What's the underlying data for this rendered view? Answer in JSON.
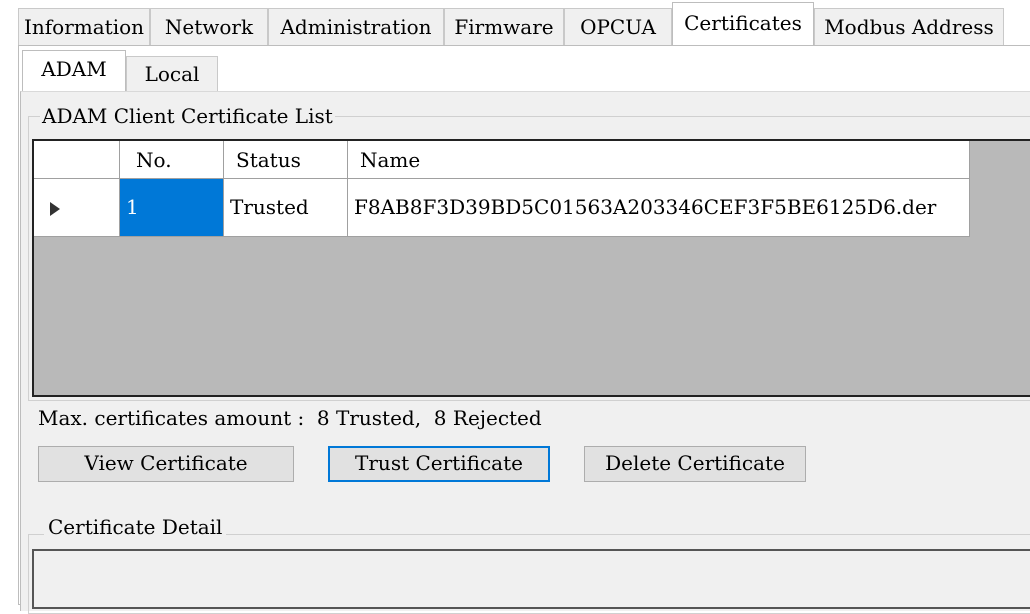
{
  "top_tabs": [
    "Information",
    "Network",
    "Administration",
    "Firmware",
    "OPCUA",
    "Certificates",
    "Modbus Address"
  ],
  "active_top_tab": "Certificates",
  "sub_tabs": [
    "ADAM",
    "Local"
  ],
  "active_sub_tab": "ADAM",
  "cert_list": {
    "group_title": "ADAM Client Certificate List",
    "columns": [
      "No.",
      "Status",
      "Name"
    ],
    "rows": [
      {
        "no": "1",
        "status": "Trusted",
        "name": "F8AB8F3D39BD5C01563A203346CEF3F5BE6125D6.der"
      }
    ]
  },
  "max_amount_text": "Max. certificates amount :  8 Trusted,  8 Rejected",
  "buttons": {
    "view": "View Certificate",
    "trust": "Trust Certificate",
    "delete": "Delete Certificate"
  },
  "detail": {
    "group_title": "Certificate Detail"
  },
  "colors": {
    "selection": "#0078d7",
    "panel": "#f0f0f0",
    "button": "#e1e1e1",
    "focus_border": "#0078d7"
  },
  "icons": {
    "row_indicator": "right-triangle"
  }
}
